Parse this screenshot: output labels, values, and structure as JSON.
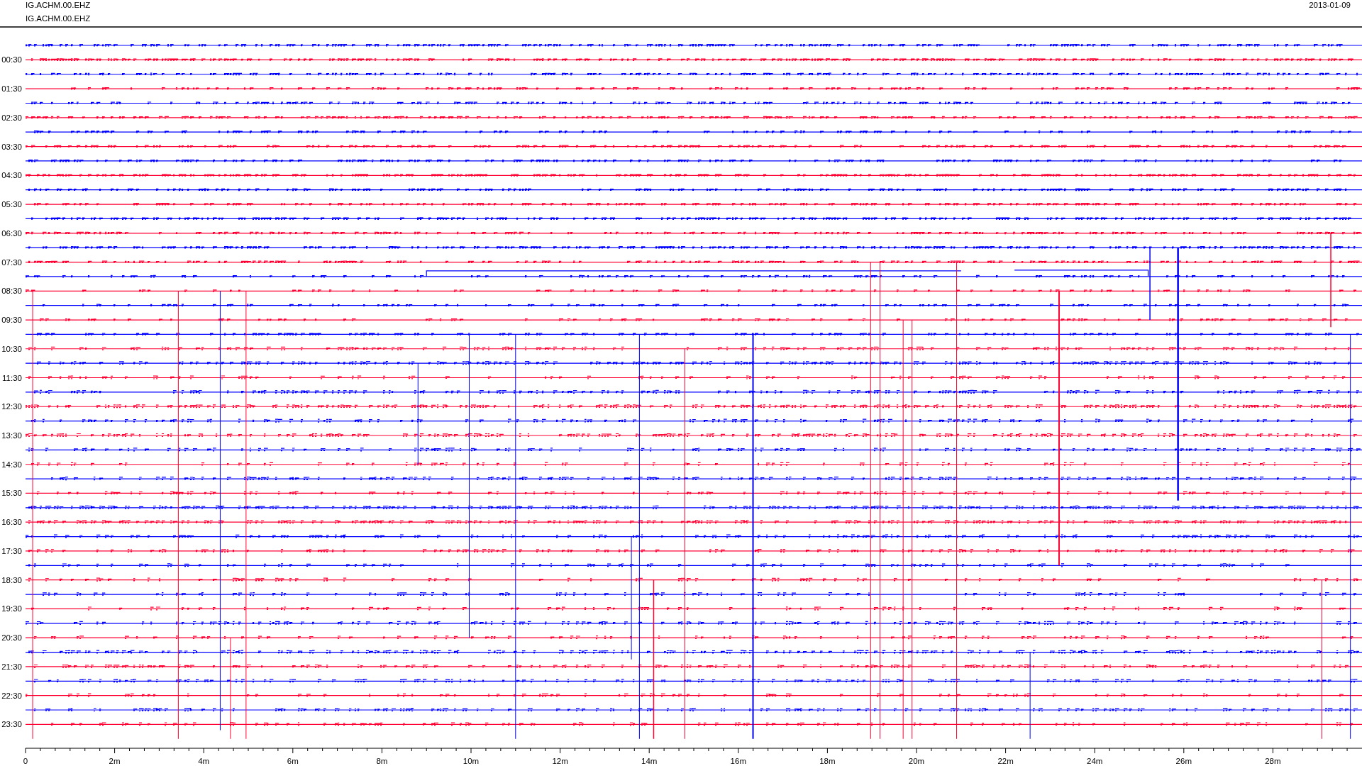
{
  "header": {
    "station_lines": [
      "IG.ACHM.00.EHZ",
      "IG.ACHM.00.EHZ"
    ],
    "date": "2013-01-09"
  },
  "plot": {
    "y_labels": [
      "00:30",
      "01:30",
      "02:30",
      "03:30",
      "04:30",
      "05:30",
      "06:30",
      "07:30",
      "08:30",
      "09:30",
      "10:30",
      "11:30",
      "12:30",
      "13:30",
      "14:30",
      "15:30",
      "16:30",
      "17:30",
      "18:30",
      "19:30",
      "20:30",
      "21:30",
      "22:30",
      "23:30"
    ],
    "x_labels": [
      "0",
      "2m",
      "4m",
      "6m",
      "8m",
      "10m",
      "12m",
      "14m",
      "16m",
      "18m",
      "20m",
      "22m",
      "24m",
      "26m",
      "28m"
    ],
    "traces": [
      {
        "color": "#0000ff"
      },
      {
        "color": "#ff0033"
      },
      {
        "color": "#0000ff"
      },
      {
        "color": "#ff0033"
      },
      {
        "color": "#0000ff"
      },
      {
        "color": "#ff0033"
      },
      {
        "color": "#0000ff"
      },
      {
        "color": "#ff0033"
      },
      {
        "color": "#0000ff"
      },
      {
        "color": "#ff0033"
      },
      {
        "color": "#0000ff"
      },
      {
        "color": "#ff0033"
      },
      {
        "color": "#0000ff"
      },
      {
        "color": "#ff0033"
      },
      {
        "color": "#0000ff"
      },
      {
        "color": "#ff0033"
      },
      {
        "color": "#0000ff"
      },
      {
        "color": "#ff0033"
      },
      {
        "color": "#0000ff"
      },
      {
        "color": "#ff0033"
      },
      {
        "color": "#0000ff"
      },
      {
        "color": "#ff0033"
      },
      {
        "color": "#0000ff"
      },
      {
        "color": "#ff0033"
      },
      {
        "color": "#0000ff"
      },
      {
        "color": "#ff0033"
      },
      {
        "color": "#0000ff"
      },
      {
        "color": "#ff0033"
      },
      {
        "color": "#0000ff"
      },
      {
        "color": "#ff0033"
      },
      {
        "color": "#0000ff"
      },
      {
        "color": "#ff0033"
      },
      {
        "color": "#0000ff"
      },
      {
        "color": "#ff0033"
      },
      {
        "color": "#0000ff"
      },
      {
        "color": "#ff0033"
      },
      {
        "color": "#0000ff"
      },
      {
        "color": "#ff0033"
      },
      {
        "color": "#0000ff"
      },
      {
        "color": "#ff0033"
      },
      {
        "color": "#0000ff"
      },
      {
        "color": "#ff0033"
      },
      {
        "color": "#0000ff"
      },
      {
        "color": "#ff0033"
      },
      {
        "color": "#0000ff"
      },
      {
        "color": "#ff0033"
      },
      {
        "color": "#0000ff"
      },
      {
        "color": "#ff0033"
      }
    ]
  }
}
